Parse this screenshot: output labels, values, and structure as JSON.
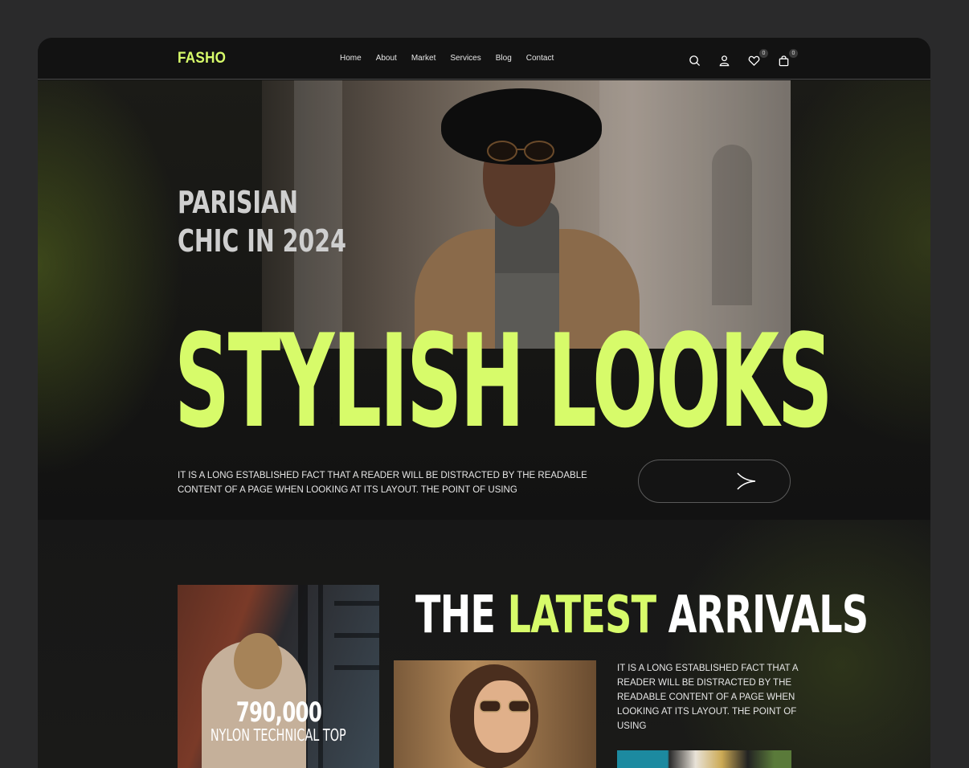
{
  "brand": {
    "logo": "FASHO",
    "accent": "#d7fb6a"
  },
  "nav": {
    "items": [
      "Home",
      "About",
      "Market",
      "Services",
      "Blog",
      "Contact"
    ],
    "icons": [
      "search-icon",
      "user-icon",
      "heart-icon",
      "bag-icon"
    ],
    "wishlist_count": "0",
    "cart_count": "0"
  },
  "hero": {
    "subtitle_line1": "PARISIAN",
    "subtitle_line2": "CHIC IN 2024",
    "title": "STYLISH LOOKS",
    "scroll_icon": "arrow-down-icon",
    "description": "IT IS A LONG ESTABLISHED FACT THAT A READER WILL BE DISTRACTED BY THE READABLE CONTENT OF A PAGE WHEN LOOKING AT ITS LAYOUT. THE POINT OF USING",
    "cta_icon": "arrow-right-icon"
  },
  "arrivals": {
    "heading_word1": "THE",
    "heading_word2": "LATEST",
    "heading_word3": "ARRIVALS",
    "feature_number": "790,000",
    "feature_caption": "NYLON TECHNICAL TOP",
    "description": "IT IS A LONG ESTABLISHED FACT THAT A READER WILL BE DISTRACTED BY THE READABLE CONTENT OF A PAGE WHEN LOOKING AT ITS LAYOUT. THE POINT OF USING"
  }
}
